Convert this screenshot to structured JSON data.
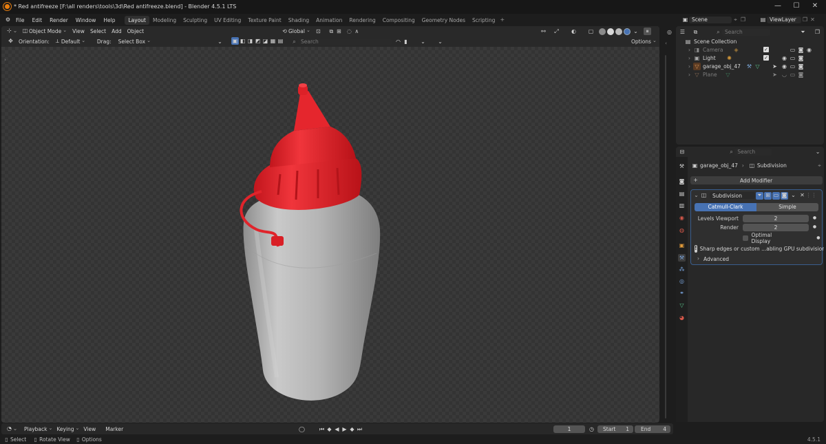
{
  "window": {
    "title": "* Red antifreeze [F:\\all renders\\tools\\3d\\Red antifreeze.blend] - Blender 4.5.1 LTS"
  },
  "menu": [
    "File",
    "Edit",
    "Render",
    "Window",
    "Help"
  ],
  "workspaces": [
    "Layout",
    "Modeling",
    "Sculpting",
    "UV Editing",
    "Texture Paint",
    "Shading",
    "Animation",
    "Rendering",
    "Compositing",
    "Geometry Nodes",
    "Scripting"
  ],
  "active_workspace": "Layout",
  "scene": {
    "name": "Scene",
    "view_layer": "ViewLayer"
  },
  "viewport": {
    "mode": "Object Mode",
    "menus": [
      "View",
      "Select",
      "Add",
      "Object"
    ],
    "transform": "Global",
    "orientation_label": "Orientation:",
    "orientation_value": "Default",
    "drag_label": "Drag:",
    "drag_value": "Select Box",
    "search_placeholder": "Search",
    "options": "Options"
  },
  "outliner": {
    "search_placeholder": "Search",
    "root": "Scene Collection",
    "items": [
      {
        "name": "Camera",
        "dim": true
      },
      {
        "name": "Light",
        "dim": false
      },
      {
        "name": "garage_obj_47",
        "dim": false
      },
      {
        "name": "Plane",
        "dim": true
      }
    ]
  },
  "properties": {
    "search_placeholder": "Search",
    "breadcrumb_object": "garage_obj_47",
    "breadcrumb_modifier": "Subdivision",
    "add_modifier": "Add Modifier",
    "modifier_name": "Subdivision",
    "algo_options": [
      "Catmull-Clark",
      "Simple"
    ],
    "algo_active": "Catmull-Clark",
    "levels_viewport_label": "Levels Viewport",
    "levels_viewport_value": "2",
    "render_label": "Render",
    "render_value": "2",
    "optimal_display": "Optimal Display",
    "warning": "Sharp edges or custom ...abling GPU subdivision",
    "advanced": "Advanced"
  },
  "timeline": {
    "menus": [
      "Playback",
      "Keying",
      "View",
      "Marker"
    ],
    "current_frame": "1",
    "start_label": "Start",
    "start_value": "1",
    "end_label": "End",
    "end_value": "4"
  },
  "status": {
    "select": "Select",
    "rotate": "Rotate View",
    "options": "Options",
    "version": "4.5.1"
  },
  "colors": {
    "cap": "#e4272e",
    "bottle": "#b9b9b9",
    "accent": "#4772b3"
  }
}
